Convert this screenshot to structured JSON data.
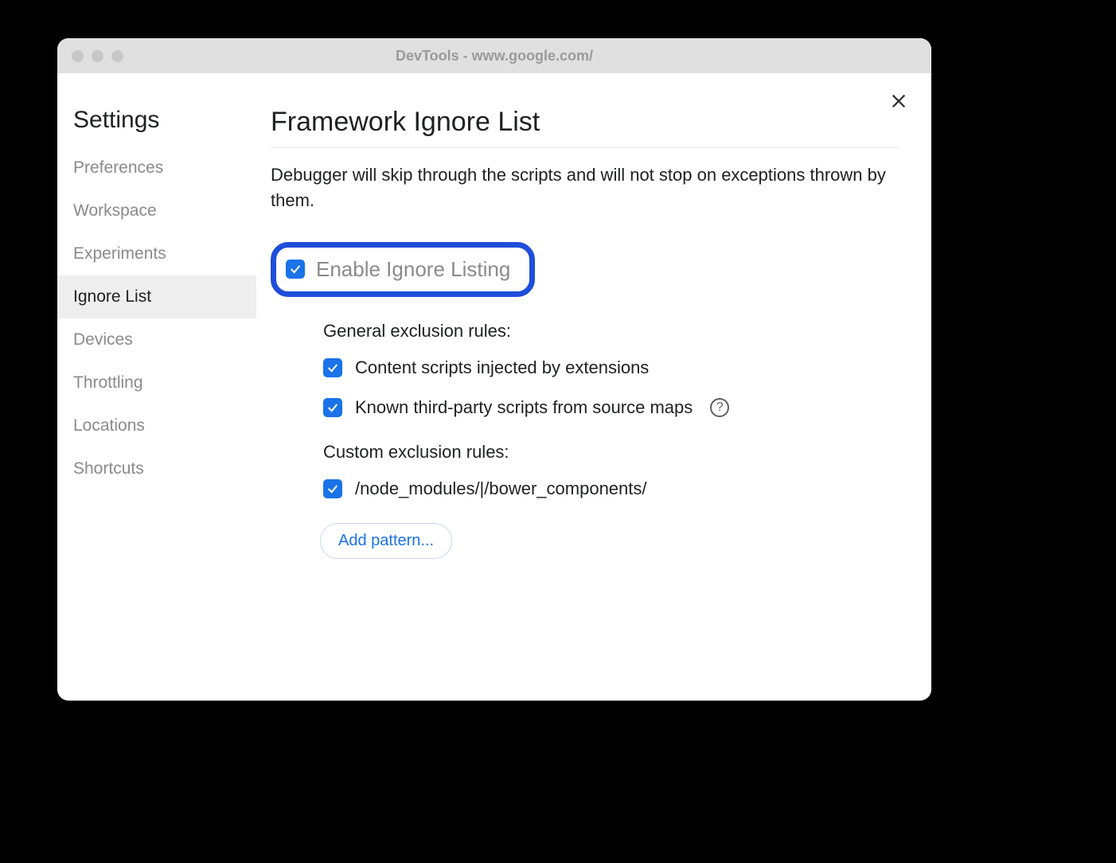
{
  "window": {
    "title": "DevTools - www.google.com/"
  },
  "sidebar": {
    "title": "Settings",
    "items": [
      {
        "label": "Preferences",
        "active": false
      },
      {
        "label": "Workspace",
        "active": false
      },
      {
        "label": "Experiments",
        "active": false
      },
      {
        "label": "Ignore List",
        "active": true
      },
      {
        "label": "Devices",
        "active": false
      },
      {
        "label": "Throttling",
        "active": false
      },
      {
        "label": "Locations",
        "active": false
      },
      {
        "label": "Shortcuts",
        "active": false
      }
    ]
  },
  "main": {
    "title": "Framework Ignore List",
    "description": "Debugger will skip through the scripts and will not stop on exceptions thrown by them.",
    "enable_label": "Enable Ignore Listing",
    "general_heading": "General exclusion rules:",
    "general_rules": [
      {
        "label": "Content scripts injected by extensions",
        "help": false
      },
      {
        "label": "Known third-party scripts from source maps",
        "help": true
      }
    ],
    "custom_heading": "Custom exclusion rules:",
    "custom_rules": [
      {
        "label": "/node_modules/|/bower_components/"
      }
    ],
    "add_pattern": "Add pattern..."
  }
}
